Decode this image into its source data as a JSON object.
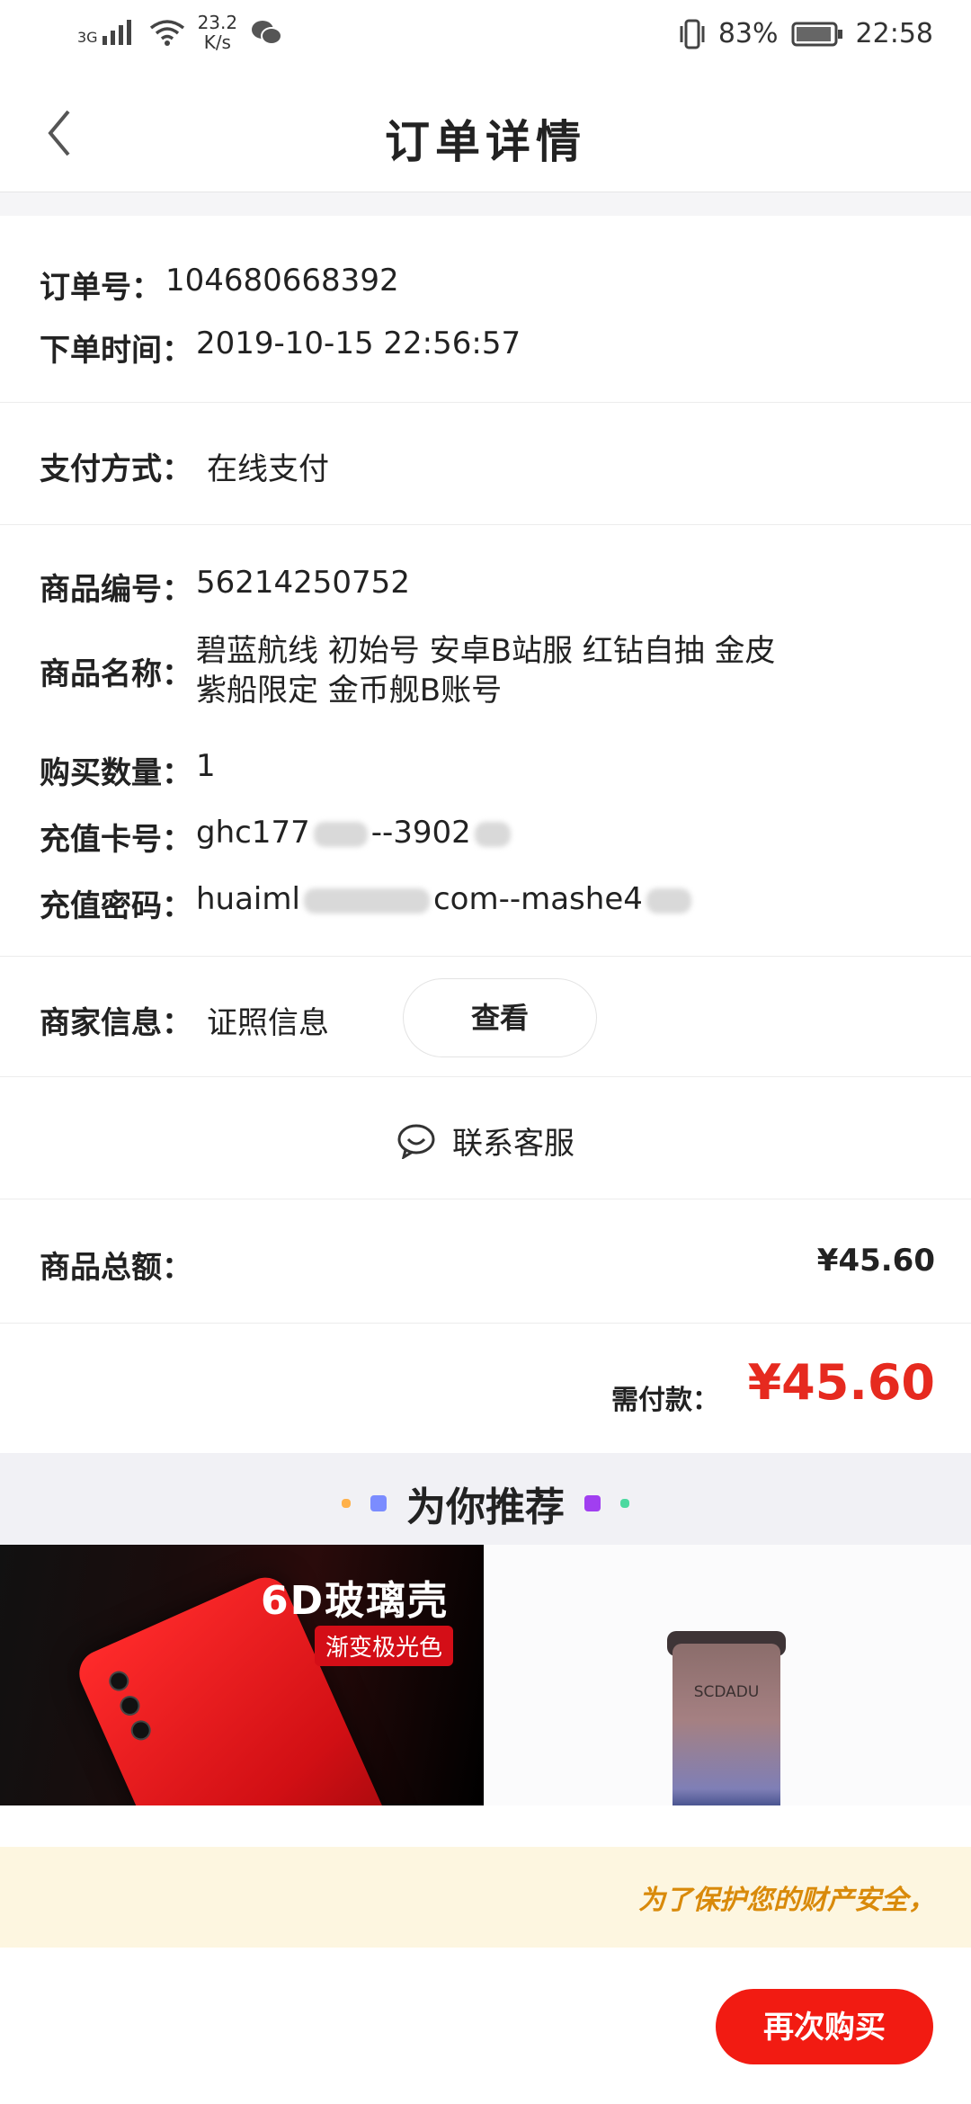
{
  "status_bar": {
    "network": "3G",
    "speed": "23.2\nK/s",
    "battery": "83%",
    "time": "22:58"
  },
  "header": {
    "title": "订单详情"
  },
  "order": {
    "order_no_label": "订单号：",
    "order_no": "104680668392",
    "order_time_label": "下单时间：",
    "order_time": "2019-10-15 22:56:57"
  },
  "payment": {
    "label": "支付方式：",
    "value": "在线支付"
  },
  "product": {
    "id_label": "商品编号：",
    "id": "56214250752",
    "name_label": "商品名称：",
    "name_line1": "碧蓝航线 初始号 安卓B站服 红钻自抽 金皮",
    "name_line2": "紫船限定 金币舰B账号",
    "qty_label": "购买数量：",
    "qty": "1",
    "card_label": "充值卡号：",
    "card_prefix": "ghc177",
    "card_suffix": "--3902",
    "pwd_label": "充值密码：",
    "pwd_prefix": "huaiml",
    "pwd_suffix": "com--mashe4"
  },
  "merchant": {
    "label": "商家信息：",
    "value": "证照信息",
    "view_button": "查看"
  },
  "service": {
    "label": "联系客服"
  },
  "totals": {
    "goods_total_label": "商品总额：",
    "goods_total": "¥45.60",
    "pay_label": "需付款：",
    "pay_value": "¥45.60"
  },
  "recommend": {
    "title": "为你推荐",
    "products": [
      {
        "banner_title": "6D玻璃壳",
        "banner_tag": "渐变极光色"
      },
      {
        "brand": "SCDADU"
      }
    ]
  },
  "notice": {
    "text": "为了保护您的财产安全，"
  },
  "actions": {
    "buy_again": "再次购买"
  },
  "colors": {
    "accent_red": "#f21b12",
    "price_red": "#e62a1f",
    "notice_bg": "#fdf6e0",
    "notice_text": "#d98a0a"
  }
}
